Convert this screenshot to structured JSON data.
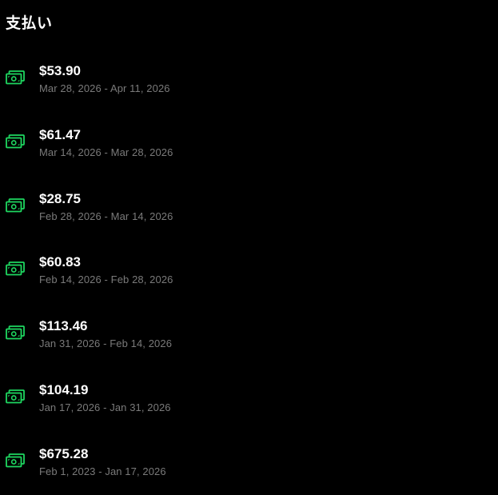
{
  "page": {
    "title": "支払い",
    "accent_color": "#1ed760"
  },
  "payments": [
    {
      "amount": "$53.90",
      "period": "Mar 28, 2026 - Apr 11, 2026",
      "icon": "cash-icon"
    },
    {
      "amount": "$61.47",
      "period": "Mar 14, 2026 - Mar 28, 2026",
      "icon": "cash-icon"
    },
    {
      "amount": "$28.75",
      "period": "Feb 28, 2026 - Mar 14, 2026",
      "icon": "cash-icon"
    },
    {
      "amount": "$60.83",
      "period": "Feb 14, 2026 - Feb 28, 2026",
      "icon": "cash-icon"
    },
    {
      "amount": "$113.46",
      "period": "Jan 31, 2026 - Feb 14, 2026",
      "icon": "cash-icon"
    },
    {
      "amount": "$104.19",
      "period": "Jan 17, 2026 - Jan 31, 2026",
      "icon": "cash-icon"
    },
    {
      "amount": "$675.28",
      "period": "Feb 1, 2023 - Jan 17, 2026",
      "icon": "cash-icon"
    }
  ]
}
